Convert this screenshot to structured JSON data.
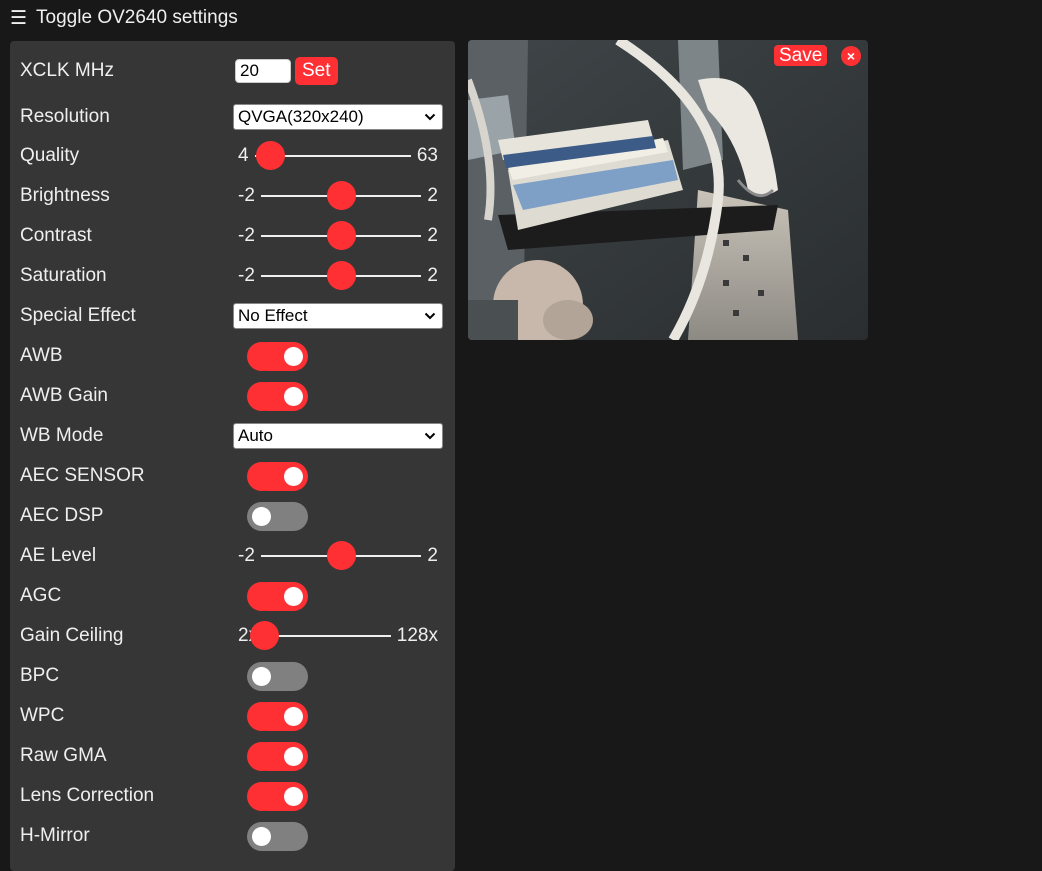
{
  "header": {
    "title": "Toggle OV2640 settings"
  },
  "settings": {
    "xclk": {
      "label": "XCLK MHz",
      "value": "20",
      "button": "Set"
    },
    "resolution": {
      "label": "Resolution",
      "selected": "QVGA(320x240)"
    },
    "quality": {
      "label": "Quality",
      "min": "4",
      "max": "63",
      "value": 10,
      "range": [
        4,
        63
      ]
    },
    "brightness": {
      "label": "Brightness",
      "min": "-2",
      "max": "2",
      "value": 0,
      "range": [
        -2,
        2
      ]
    },
    "contrast": {
      "label": "Contrast",
      "min": "-2",
      "max": "2",
      "value": 0,
      "range": [
        -2,
        2
      ]
    },
    "saturation": {
      "label": "Saturation",
      "min": "-2",
      "max": "2",
      "value": 0,
      "range": [
        -2,
        2
      ]
    },
    "special_effect": {
      "label": "Special Effect",
      "selected": "No Effect"
    },
    "awb": {
      "label": "AWB",
      "on": true
    },
    "awb_gain": {
      "label": "AWB Gain",
      "on": true
    },
    "wb_mode": {
      "label": "WB Mode",
      "selected": "Auto"
    },
    "aec_sensor": {
      "label": "AEC SENSOR",
      "on": true
    },
    "aec_dsp": {
      "label": "AEC DSP",
      "on": false
    },
    "ae_level": {
      "label": "AE Level",
      "min": "-2",
      "max": "2",
      "value": 0,
      "range": [
        -2,
        2
      ]
    },
    "agc": {
      "label": "AGC",
      "on": true
    },
    "gain_ceiling": {
      "label": "Gain Ceiling",
      "min": "2x",
      "max": "128x",
      "value": 0,
      "range": [
        0,
        6
      ]
    },
    "bpc": {
      "label": "BPC",
      "on": false
    },
    "wpc": {
      "label": "WPC",
      "on": true
    },
    "raw_gma": {
      "label": "Raw GMA",
      "on": true
    },
    "lens_correction": {
      "label": "Lens Correction",
      "on": true
    },
    "h_mirror": {
      "label": "H-Mirror",
      "on": false
    }
  },
  "stream": {
    "save_label": "Save",
    "close_label": "×"
  },
  "icons": {
    "menu": "hamburger-icon",
    "chevron": "chevron-down-icon",
    "close": "close-icon"
  },
  "colors": {
    "accent": "#ff3034",
    "panel": "#363636",
    "background": "#181818",
    "toggle_off": "#808080"
  }
}
